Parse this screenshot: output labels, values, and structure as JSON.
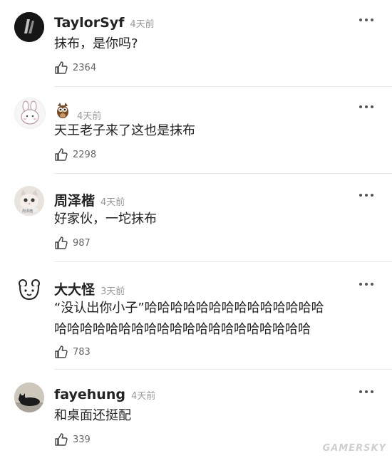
{
  "comments": [
    {
      "username": "TaylorSyf",
      "time": "4天前",
      "text": "抹布，是你吗?",
      "likes": "2364"
    },
    {
      "username": "",
      "time": "4天前",
      "text": "天王老子来了这也是抹布",
      "likes": "2298"
    },
    {
      "username": "周泽楷",
      "time": "4天前",
      "text": "好家伙，一坨抹布",
      "likes": "987"
    },
    {
      "username": "大大怪",
      "time": "3天前",
      "text_line1": "“没认出你小子”哈哈哈哈哈哈哈哈哈哈哈哈哈哈",
      "text_line2": "哈哈哈哈哈哈哈哈哈哈哈哈哈哈哈哈哈哈哈哈",
      "likes": "783"
    },
    {
      "username": "fayehung",
      "time": "4天前",
      "text": "和桌面还挺配",
      "likes": "339"
    }
  ],
  "avatar_labels": {
    "avatar_3": "周泽楷"
  },
  "watermark": "GAMERSKY",
  "colors": {
    "text": "#222222",
    "muted": "#9a9a9a",
    "separator": "#e9e9e9"
  }
}
